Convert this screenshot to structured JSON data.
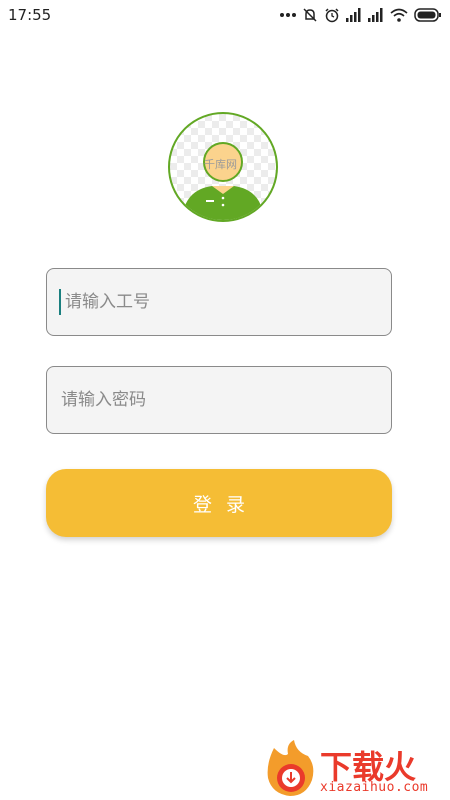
{
  "status_bar": {
    "time": "17:55",
    "icons": [
      "more-dots-icon",
      "mute-icon",
      "alarm-icon",
      "signal-icon",
      "signal-icon",
      "wifi-icon",
      "battery-icon"
    ]
  },
  "avatar": {
    "watermark": "千库网",
    "colors": {
      "ring": "#62a824",
      "shirt": "#62a824",
      "face": "#fbd38d"
    }
  },
  "form": {
    "employee_id_placeholder": "请输入工号",
    "password_placeholder": "请输入密码",
    "login_label": "登录",
    "login_color": "#f5bd35"
  },
  "watermark_logo": {
    "brand": "下载火",
    "domain": "xiazaihuo.com",
    "color": "#ea3a2b"
  }
}
